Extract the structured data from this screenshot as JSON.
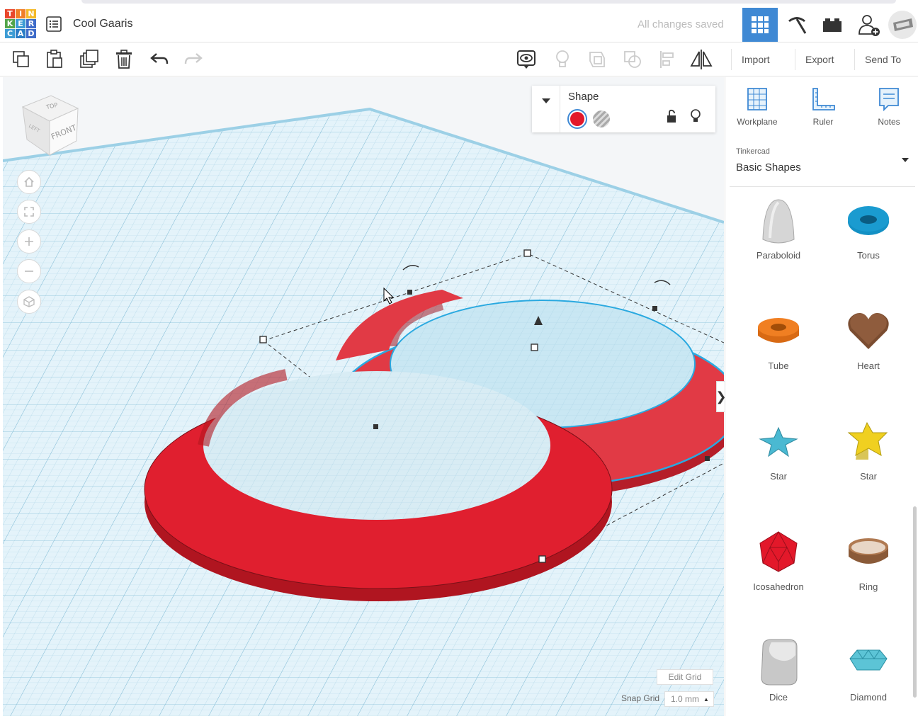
{
  "app": {
    "logo_letters": [
      "T",
      "I",
      "N",
      "K",
      "E",
      "R",
      "C",
      "A",
      "D"
    ],
    "logo_colors": [
      "#e8472b",
      "#f07f28",
      "#f4b928",
      "#53a54a",
      "#3d9cd4",
      "#3f6cc9",
      "#3d9cd4",
      "#2b7dc6",
      "#3f6cc9"
    ],
    "project_title": "Cool Gaaris",
    "save_status": "All changes saved"
  },
  "header": {
    "buttons": [
      {
        "name": "3d-design-view-button",
        "icon": "grid-icon",
        "active": true
      },
      {
        "name": "codeblocks-button",
        "icon": "pickaxe-icon",
        "active": false
      },
      {
        "name": "bricks-button",
        "icon": "brick-icon",
        "active": false
      },
      {
        "name": "share-user-button",
        "icon": "add-user-icon",
        "active": false
      }
    ]
  },
  "toolbar": {
    "import_label": "Import",
    "export_label": "Export",
    "send_to_label": "Send To"
  },
  "shape_panel": {
    "label": "Shape",
    "color": "#e3182a"
  },
  "sidebar": {
    "tools": [
      {
        "label": "Workplane",
        "icon": "workplane-icon"
      },
      {
        "label": "Ruler",
        "icon": "ruler-icon"
      },
      {
        "label": "Notes",
        "icon": "notes-icon"
      }
    ],
    "library": {
      "source": "Tinkercad",
      "category": "Basic Shapes"
    },
    "shapes": [
      {
        "label": "Paraboloid",
        "icon": "paraboloid-icon",
        "color": "#d4d4d4"
      },
      {
        "label": "Torus",
        "icon": "torus-icon",
        "color": "#1a9bd0"
      },
      {
        "label": "Tube",
        "icon": "tube-icon",
        "color": "#f07f22"
      },
      {
        "label": "Heart",
        "icon": "heart-icon",
        "color": "#8a5a3c"
      },
      {
        "label": "Star",
        "icon": "star-icon",
        "color": "#4ab9d2"
      },
      {
        "label": "Star",
        "icon": "star-icon",
        "color": "#f0d020"
      },
      {
        "label": "Icosahedron",
        "icon": "icosahedron-icon",
        "color": "#e3182a"
      },
      {
        "label": "Ring",
        "icon": "ring-icon",
        "color": "#9b6a45"
      },
      {
        "label": "Dice",
        "icon": "dice-icon",
        "color": "#c8c8c8"
      },
      {
        "label": "Diamond",
        "icon": "diamond-icon",
        "color": "#5cc4d6"
      }
    ]
  },
  "viewport": {
    "viewcube": {
      "top": "TOP",
      "left": "LEFT",
      "front": "FRONT"
    },
    "edit_grid_label": "Edit Grid",
    "snap_grid_label": "Snap Grid",
    "snap_grid_value": "1.0 mm"
  }
}
